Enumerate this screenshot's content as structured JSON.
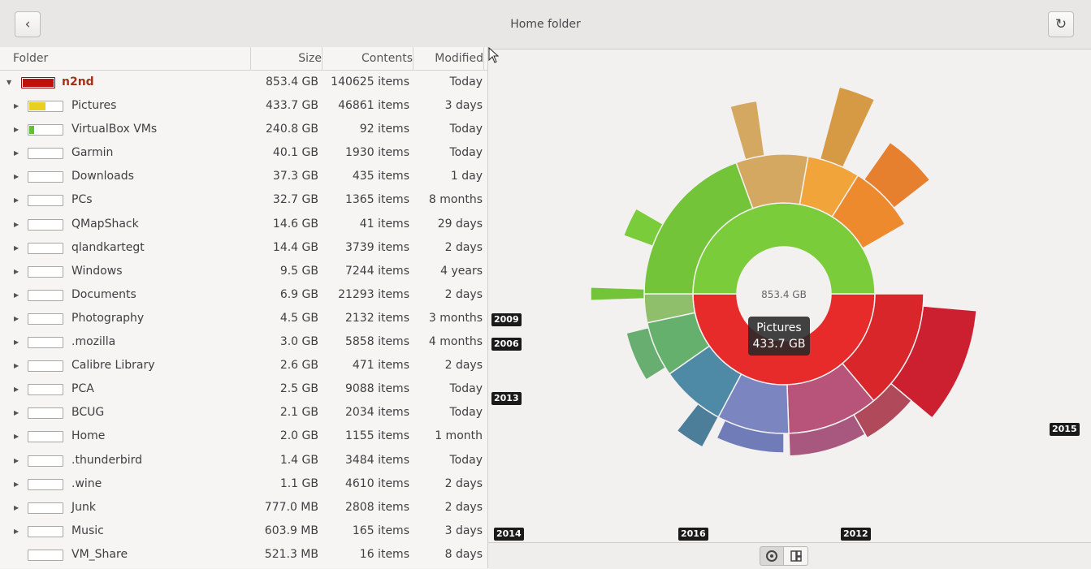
{
  "window": {
    "title": "Home folder"
  },
  "header": {
    "back_icon": "chevron-left-icon",
    "reload_icon": "reload-icon"
  },
  "table": {
    "columns": [
      "Folder",
      "Size",
      "Contents",
      "Modified"
    ],
    "rows": [
      {
        "name": "n2nd",
        "size": "853.4 GB",
        "contents": "140625 items",
        "modified": "Today",
        "usage": 1.0,
        "color": "#c00f0f",
        "root": true
      },
      {
        "name": "Pictures",
        "size": "433.7 GB",
        "contents": "46861 items",
        "modified": "3 days",
        "usage": 0.51,
        "color": "#e9cf1f"
      },
      {
        "name": "VirtualBox VMs",
        "size": "240.8 GB",
        "contents": "92 items",
        "modified": "Today",
        "usage": 0.16,
        "color": "#61c134"
      },
      {
        "name": "Garmin",
        "size": "40.1 GB",
        "contents": "1930 items",
        "modified": "Today",
        "usage": 0.0
      },
      {
        "name": "Downloads",
        "size": "37.3 GB",
        "contents": "435 items",
        "modified": "1 day",
        "usage": 0.0
      },
      {
        "name": "PCs",
        "size": "32.7 GB",
        "contents": "1365 items",
        "modified": "8 months",
        "usage": 0.0
      },
      {
        "name": "QMapShack",
        "size": "14.6 GB",
        "contents": "41 items",
        "modified": "29 days",
        "usage": 0.0
      },
      {
        "name": "qlandkartegt",
        "size": "14.4 GB",
        "contents": "3739 items",
        "modified": "2 days",
        "usage": 0.0
      },
      {
        "name": "Windows",
        "size": "9.5 GB",
        "contents": "7244 items",
        "modified": "4 years",
        "usage": 0.0
      },
      {
        "name": "Documents",
        "size": "6.9 GB",
        "contents": "21293 items",
        "modified": "2 days",
        "usage": 0.0
      },
      {
        "name": "Photography",
        "size": "4.5 GB",
        "contents": "2132 items",
        "modified": "3 months",
        "usage": 0.0
      },
      {
        "name": ".mozilla",
        "size": "3.0 GB",
        "contents": "5858 items",
        "modified": "4 months",
        "usage": 0.0
      },
      {
        "name": "Calibre Library",
        "size": "2.6 GB",
        "contents": "471 items",
        "modified": "2 days",
        "usage": 0.0
      },
      {
        "name": "PCA",
        "size": "2.5 GB",
        "contents": "9088 items",
        "modified": "Today",
        "usage": 0.0
      },
      {
        "name": "BCUG",
        "size": "2.1 GB",
        "contents": "2034 items",
        "modified": "Today",
        "usage": 0.0
      },
      {
        "name": "Home",
        "size": "2.0 GB",
        "contents": "1155 items",
        "modified": "1 month",
        "usage": 0.0
      },
      {
        "name": ".thunderbird",
        "size": "1.4 GB",
        "contents": "3484 items",
        "modified": "Today",
        "usage": 0.0
      },
      {
        "name": ".wine",
        "size": "1.1 GB",
        "contents": "4610 items",
        "modified": "2 days",
        "usage": 0.0
      },
      {
        "name": "Junk",
        "size": "777.0 MB",
        "contents": "2808 items",
        "modified": "2 days",
        "usage": 0.0
      },
      {
        "name": "Music",
        "size": "603.9 MB",
        "contents": "165 items",
        "modified": "3 days",
        "usage": 0.0
      },
      {
        "name": "VM_Share",
        "size": "521.3 MB",
        "contents": "16 items",
        "modified": "8 days",
        "usage": 0.0,
        "leaf": true
      }
    ]
  },
  "chart": {
    "center_label": "853.4 GB",
    "tooltip": {
      "name": "Pictures",
      "size": "433.7 GB"
    },
    "callouts": [
      "2009",
      "2006",
      "2013",
      "2014",
      "2016",
      "2012",
      "2015"
    ]
  },
  "view_toggle": {
    "rings_icon": "rings-chart-icon",
    "treemap_icon": "treemap-icon"
  }
}
